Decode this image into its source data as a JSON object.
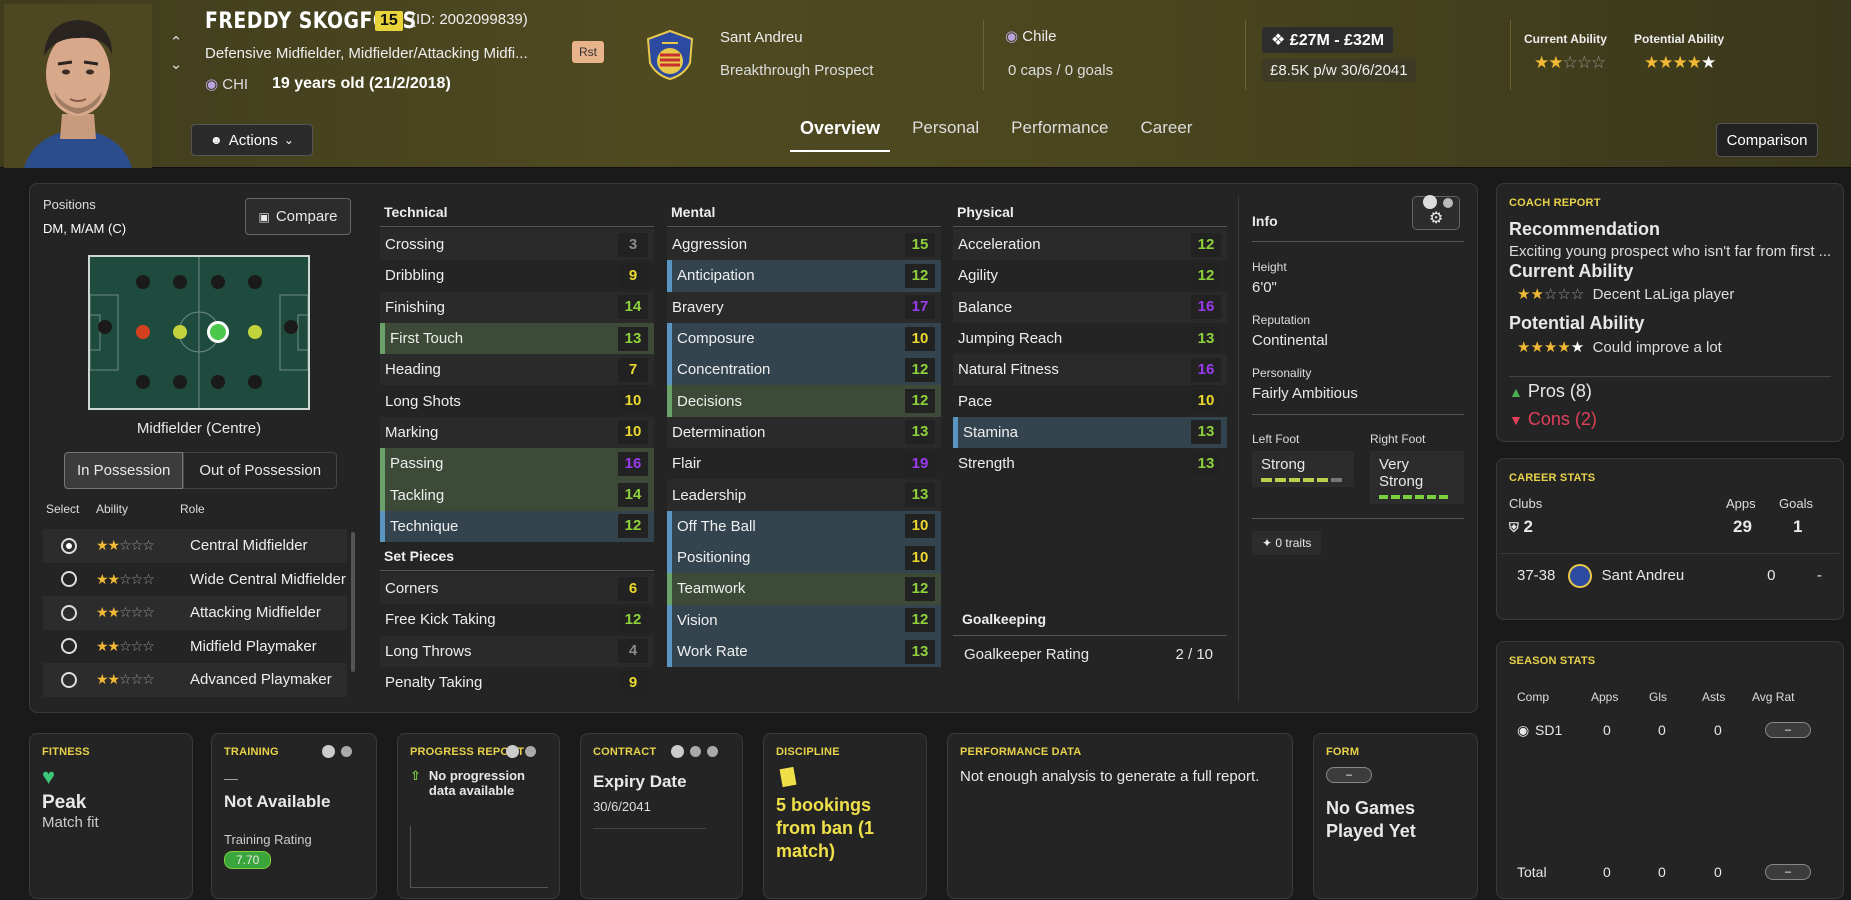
{
  "header": {
    "name": "FREDDY SKOGFOSS",
    "ca_badge": "15",
    "id": "(ID: 2002099839)",
    "positions": "Defensive Midfielder, Midfielder/Attacking Midfi...",
    "rst": "Rst",
    "nationality": "CHI",
    "age": "19 years old (21/2/2018)",
    "club": "Sant Andreu",
    "club_status": "Breakthrough Prospect",
    "country": "Chile",
    "caps": "0 caps / 0 goals",
    "value": "£27M - £32M",
    "wage": "£8.5K p/w",
    "contract_end": "30/6/2041",
    "current_ability_label": "Current Ability",
    "potential_ability_label": "Potential Ability",
    "current_ability_stars": 2,
    "potential_ability_stars": 4.5,
    "actions_label": "Actions",
    "tabs": [
      "Overview",
      "Personal",
      "Performance",
      "Career"
    ],
    "active_tab": "Overview",
    "comparison_label": "Comparison"
  },
  "positions_panel": {
    "title": "Positions",
    "value": "DM, M/AM (C)",
    "compare_label": "Compare",
    "selected_position": "Midfielder (Centre)",
    "toggle": [
      "In Possession",
      "Out of Possession"
    ],
    "roles_headers": [
      "Select",
      "Ability",
      "Role"
    ],
    "roles": [
      {
        "name": "Central Midfielder",
        "stars": 2,
        "selected": true
      },
      {
        "name": "Wide Central Midfielder",
        "stars": 2,
        "selected": false
      },
      {
        "name": "Attacking Midfielder",
        "stars": 2,
        "selected": false
      },
      {
        "name": "Midfield Playmaker",
        "stars": 2,
        "selected": false
      },
      {
        "name": "Advanced Playmaker",
        "stars": 2,
        "selected": false
      }
    ]
  },
  "technical": {
    "title": "Technical",
    "rows": [
      {
        "name": "Crossing",
        "value": "3"
      },
      {
        "name": "Dribbling",
        "value": "9"
      },
      {
        "name": "Finishing",
        "value": "14"
      },
      {
        "name": "First Touch",
        "value": "13"
      },
      {
        "name": "Heading",
        "value": "7"
      },
      {
        "name": "Long Shots",
        "value": "10"
      },
      {
        "name": "Marking",
        "value": "10"
      },
      {
        "name": "Passing",
        "value": "16"
      },
      {
        "name": "Tackling",
        "value": "14"
      },
      {
        "name": "Technique",
        "value": "12"
      }
    ],
    "set_pieces_title": "Set Pieces",
    "set_pieces": [
      {
        "name": "Corners",
        "value": "6"
      },
      {
        "name": "Free Kick Taking",
        "value": "12"
      },
      {
        "name": "Long Throws",
        "value": "4"
      },
      {
        "name": "Penalty Taking",
        "value": "9"
      }
    ]
  },
  "mental": {
    "title": "Mental",
    "rows": [
      {
        "name": "Aggression",
        "value": "15"
      },
      {
        "name": "Anticipation",
        "value": "12"
      },
      {
        "name": "Bravery",
        "value": "17"
      },
      {
        "name": "Composure",
        "value": "10"
      },
      {
        "name": "Concentration",
        "value": "12"
      },
      {
        "name": "Decisions",
        "value": "12"
      },
      {
        "name": "Determination",
        "value": "13"
      },
      {
        "name": "Flair",
        "value": "19"
      },
      {
        "name": "Leadership",
        "value": "13"
      },
      {
        "name": "Off The Ball",
        "value": "10"
      },
      {
        "name": "Positioning",
        "value": "10"
      },
      {
        "name": "Teamwork",
        "value": "12"
      },
      {
        "name": "Vision",
        "value": "12"
      },
      {
        "name": "Work Rate",
        "value": "13"
      }
    ]
  },
  "physical": {
    "title": "Physical",
    "rows": [
      {
        "name": "Acceleration",
        "value": "12"
      },
      {
        "name": "Agility",
        "value": "12"
      },
      {
        "name": "Balance",
        "value": "16"
      },
      {
        "name": "Jumping Reach",
        "value": "13"
      },
      {
        "name": "Natural Fitness",
        "value": "16"
      },
      {
        "name": "Pace",
        "value": "10"
      },
      {
        "name": "Stamina",
        "value": "13"
      },
      {
        "name": "Strength",
        "value": "13"
      }
    ],
    "gk_title": "Goalkeeping",
    "gk_label": "Goalkeeper Rating",
    "gk_value": "2 / 10"
  },
  "info": {
    "title": "Info",
    "height_label": "Height",
    "height": "6'0\"",
    "reputation_label": "Reputation",
    "reputation": "Continental",
    "personality_label": "Personality",
    "personality": "Fairly Ambitious",
    "left_foot_label": "Left Foot",
    "left_foot": "Strong",
    "right_foot_label": "Right Foot",
    "right_foot": "Very Strong",
    "traits": "0 traits"
  },
  "coach_report": {
    "section": "COACH REPORT",
    "recommendation_title": "Recommendation",
    "recommendation": "Exciting young prospect who isn't far from first ...",
    "ca_title": "Current Ability",
    "ca_text": "Decent LaLiga player",
    "pa_title": "Potential Ability",
    "pa_text": "Could improve a lot",
    "pros": "Pros (8)",
    "cons": "Cons (2)"
  },
  "career_stats": {
    "section": "CAREER STATS",
    "clubs_label": "Clubs",
    "clubs": "2",
    "apps_label": "Apps",
    "apps": "29",
    "goals_label": "Goals",
    "goals": "1",
    "row": {
      "season": "37-38",
      "club": "Sant Andreu",
      "apps": "0",
      "goals": "-"
    }
  },
  "season_stats": {
    "section": "SEASON STATS",
    "headers": [
      "Comp",
      "Apps",
      "Gls",
      "Asts",
      "Avg Rat"
    ],
    "row": {
      "comp": "SD1",
      "apps": "0",
      "gls": "0",
      "asts": "0",
      "rat": "–"
    },
    "total": {
      "label": "Total",
      "apps": "0",
      "gls": "0",
      "asts": "0",
      "rat": "–"
    }
  },
  "cards": {
    "fitness": {
      "section": "FITNESS",
      "value": "Peak",
      "sub": "Match fit"
    },
    "training": {
      "section": "TRAINING",
      "dash": "—",
      "value": "Not Available",
      "rating_label": "Training Rating",
      "rating": "7.70"
    },
    "progress": {
      "section": "PROGRESS REPORT",
      "text": "No progression data available"
    },
    "contract": {
      "section": "CONTRACT",
      "title": "Expiry Date",
      "date": "30/6/2041"
    },
    "discipline": {
      "section": "DISCIPLINE",
      "text": "5 bookings from ban (1 match)"
    },
    "performance": {
      "section": "PERFORMANCE DATA",
      "text": "Not enough analysis to generate a full report."
    },
    "form": {
      "section": "FORM",
      "pill": "–",
      "text": "No Games Played Yet"
    }
  },
  "colors": {
    "accent": "#e8d24a",
    "green": "#8fd13d",
    "yellow": "#ebd82e",
    "purple": "#9a3bf0",
    "pros": "#4caf50",
    "cons": "#e0405a"
  }
}
